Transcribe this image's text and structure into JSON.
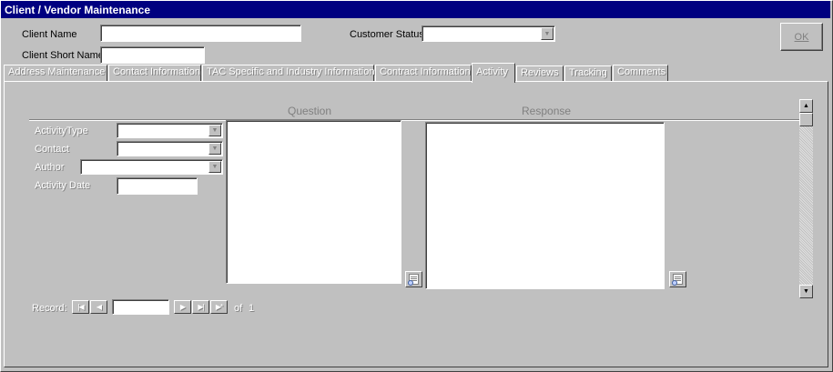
{
  "window": {
    "title": "Client / Vendor Maintenance"
  },
  "header": {
    "client_name_label": "Client Name",
    "client_name_value": "",
    "client_short_name_label": "Client Short Name",
    "client_short_name_value": "",
    "customer_status_label": "Customer Status",
    "customer_status_value": "",
    "ok_label": "OK"
  },
  "tabs": [
    {
      "label": "Address Maintenance"
    },
    {
      "label": "Contact Information"
    },
    {
      "label": "TAC Specific and Industry Information"
    },
    {
      "label": "Contract Information"
    },
    {
      "label": "Activity",
      "active": true
    },
    {
      "label": "Reviews"
    },
    {
      "label": "Tracking"
    },
    {
      "label": "Comments"
    }
  ],
  "activity": {
    "question_header": "Question",
    "response_header": "Response",
    "activity_type_label": "ActivityType",
    "contact_label": "Contact",
    "author_label": "Author",
    "activity_date_label": "Activity Date",
    "question_text": "",
    "response_text": ""
  },
  "record_nav": {
    "label": "Record:",
    "current": "",
    "of_label": "of",
    "total": "1"
  },
  "icons": {
    "dropdown": "chevron-down-icon",
    "zoom": "zoom-icon",
    "first": "first-record-icon",
    "prev": "prev-record-icon",
    "next": "next-record-icon",
    "last": "last-record-icon",
    "new": "new-record-icon"
  },
  "colors": {
    "titlebar": "#000080",
    "face": "#c0c0c0"
  }
}
